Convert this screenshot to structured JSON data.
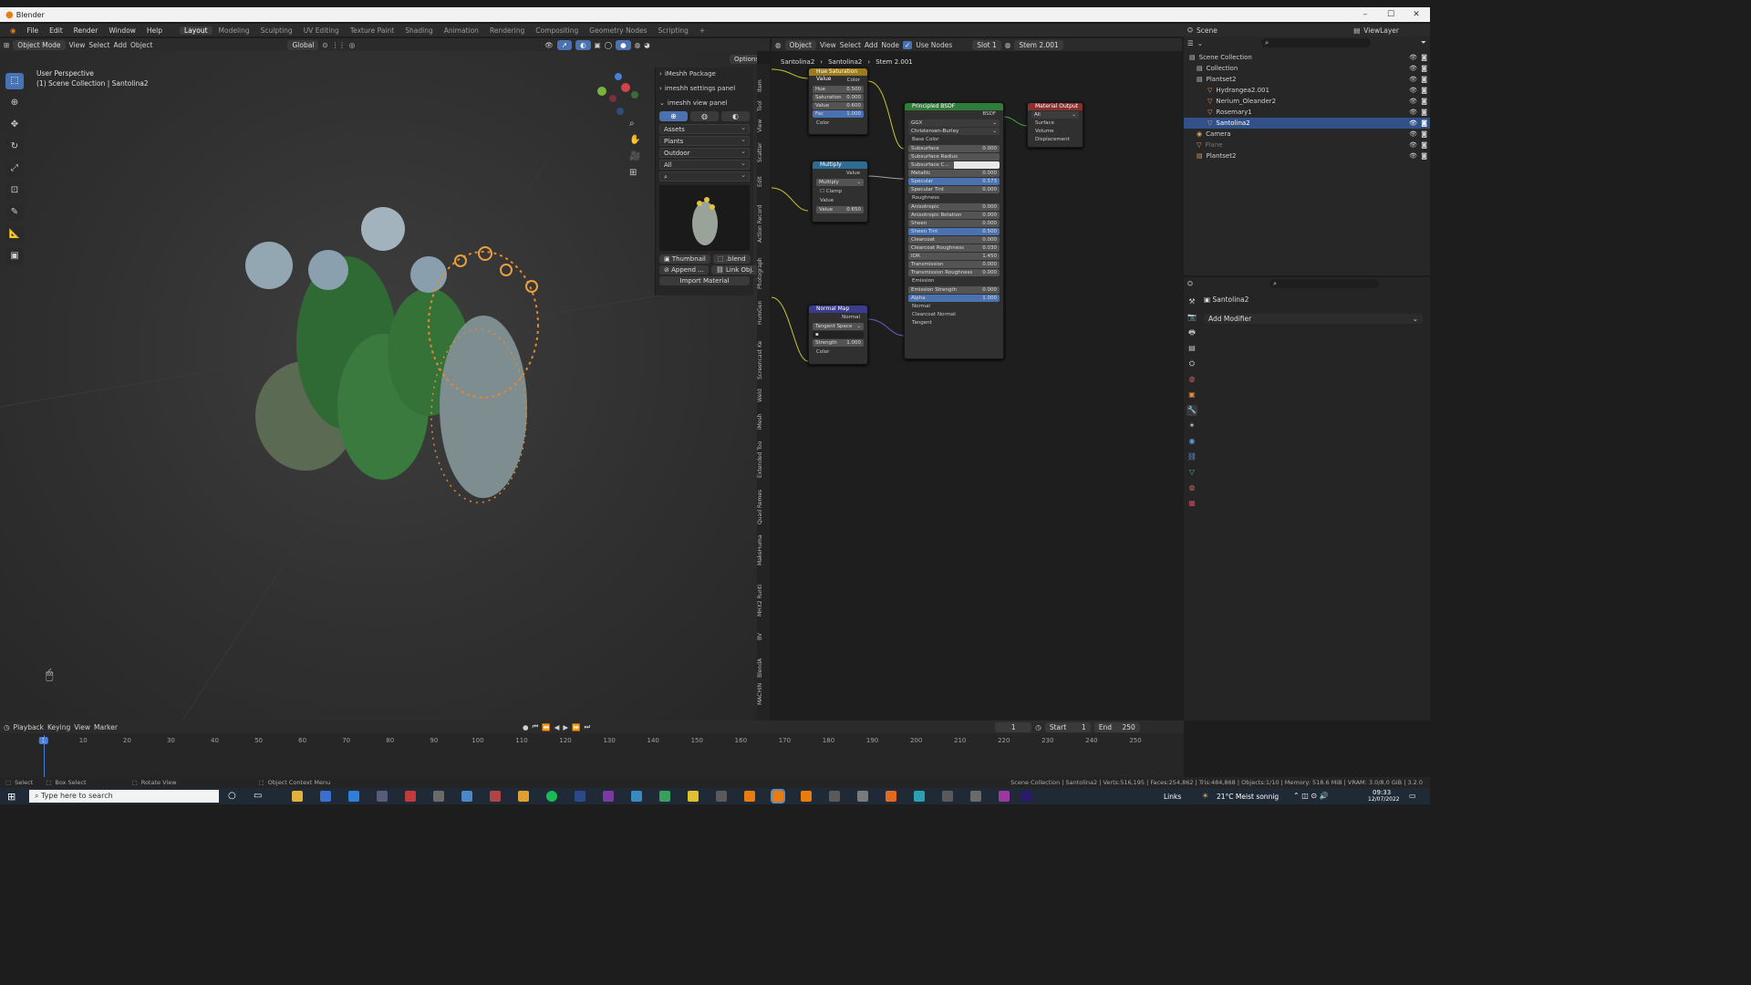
{
  "app": {
    "title": "Blender"
  },
  "menu": [
    "File",
    "Edit",
    "Render",
    "Window",
    "Help"
  ],
  "workspaces": [
    "Layout",
    "Modeling",
    "Sculpting",
    "UV Editing",
    "Texture Paint",
    "Shading",
    "Animation",
    "Rendering",
    "Compositing",
    "Geometry Nodes",
    "Scripting"
  ],
  "workspace_add": "+",
  "viewport": {
    "mode": "Object Mode",
    "menus": [
      "View",
      "Select",
      "Add",
      "Object"
    ],
    "orientation": "Global",
    "options": "Options",
    "overlay_title": "User Perspective",
    "overlay_sub": "(1) Scene Collection | Santolina2"
  },
  "npanel": {
    "headers": [
      "iMeshh Package",
      "imeshh settings panel",
      "imeshh view panel"
    ],
    "selects": [
      "Assets",
      "Plants",
      "Outdoor",
      "All"
    ],
    "thumbnail": "Thumbnail",
    "blend": ".blend",
    "append": "Append ...",
    "link": "Link Obj.",
    "import": "Import Material"
  },
  "vtabs": [
    "Item",
    "Tool",
    "View",
    "Scatter",
    "Edit",
    "Action Record",
    "Photograph",
    "HumGen",
    "Screencast Ke",
    "Weld",
    "iMesh",
    "Extended Too",
    "Quad Remes",
    "MakeHuma",
    "MHX2 Runti",
    "BV",
    "BlendA",
    "MACHIN"
  ],
  "node_editor": {
    "header": {
      "object": "Object",
      "menus": [
        "View",
        "Select",
        "Add",
        "Node"
      ],
      "use_nodes": "Use Nodes",
      "slot": "Slot 1",
      "material": "Stem 2.001"
    },
    "breadcrumb": [
      "Santolina2",
      "Santolina2",
      "Stem 2.001"
    ],
    "hsv": {
      "title": "Hue Saturation Value",
      "out": "Color",
      "fields": [
        {
          "l": "Hue",
          "v": "0.500"
        },
        {
          "l": "Saturation",
          "v": "0.000"
        },
        {
          "l": "Value",
          "v": "0.600"
        },
        {
          "l": "Fac",
          "v": "1.000"
        }
      ],
      "in": "Color"
    },
    "multiply": {
      "title": "Multiply",
      "out": "Value",
      "op": "Multiply",
      "clamp": "Clamp",
      "in": "Value",
      "value_l": "Value",
      "value_v": "0.650"
    },
    "normalmap": {
      "title": "Normal Map",
      "out": "Normal",
      "space": "Tangent Space",
      "strength_l": "Strength",
      "strength_v": "1.000",
      "in": "Color"
    },
    "bsdf": {
      "title": "Principled BSDF",
      "out": "BSDF",
      "dist": "GGX",
      "ss": "Christensen-Burley",
      "rows": [
        {
          "l": "Base Color",
          "v": ""
        },
        {
          "l": "Subsurface",
          "v": "0.000",
          "f": 1
        },
        {
          "l": "Subsurface Radius",
          "v": "",
          "f": 1
        },
        {
          "l": "Subsurface C...",
          "v": "",
          "f": 1,
          "w": 1
        },
        {
          "l": "Metallic",
          "v": "0.000",
          "f": 1
        },
        {
          "l": "Specular",
          "v": "0.573",
          "f": 1,
          "b": 1
        },
        {
          "l": "Specular Tint",
          "v": "0.000",
          "f": 1
        },
        {
          "l": "Roughness",
          "v": ""
        },
        {
          "l": "Anisotropic",
          "v": "0.000",
          "f": 1
        },
        {
          "l": "Anisotropic Rotation",
          "v": "0.000",
          "f": 1
        },
        {
          "l": "Sheen",
          "v": "0.000",
          "f": 1
        },
        {
          "l": "Sheen Tint",
          "v": "0.500",
          "f": 1,
          "b": 1
        },
        {
          "l": "Clearcoat",
          "v": "0.000",
          "f": 1
        },
        {
          "l": "Clearcoat Roughness",
          "v": "0.030",
          "f": 1
        },
        {
          "l": "IOR",
          "v": "1.450",
          "f": 1
        },
        {
          "l": "Transmission",
          "v": "0.000",
          "f": 1
        },
        {
          "l": "Transmission Roughness",
          "v": "0.000",
          "f": 1
        },
        {
          "l": "Emission",
          "v": ""
        },
        {
          "l": "Emission Strength",
          "v": "0.000",
          "f": 1
        },
        {
          "l": "Alpha",
          "v": "1.000",
          "f": 1,
          "b": 1
        },
        {
          "l": "Normal",
          "v": ""
        },
        {
          "l": "Clearcoat Normal",
          "v": ""
        },
        {
          "l": "Tangent",
          "v": ""
        }
      ]
    },
    "output": {
      "title": "Material Output",
      "target": "All",
      "rows": [
        "Surface",
        "Volume",
        "Displacement"
      ]
    }
  },
  "outliner": {
    "scene": "Scene",
    "viewlayer": "ViewLayer",
    "rows": [
      "Scene Collection",
      "Collection",
      "Plantset2",
      "Hydrangea2.001",
      "Nerium_Oleander2",
      "Rosemary1",
      "Santolina2",
      "Camera",
      "Plane",
      "Plantset2"
    ]
  },
  "properties": {
    "object": "Santolina2",
    "add_modifier": "Add Modifier"
  },
  "timeline": {
    "menus": [
      "Playback",
      "Keying",
      "View",
      "Marker"
    ],
    "current": "1",
    "start_l": "Start",
    "start": "1",
    "end_l": "End",
    "end": "250",
    "ticks": [
      "1",
      "10",
      "20",
      "30",
      "40",
      "50",
      "60",
      "70",
      "80",
      "90",
      "100",
      "110",
      "120",
      "130",
      "140",
      "150",
      "160",
      "170",
      "180",
      "190",
      "200",
      "210",
      "220",
      "230",
      "240",
      "250"
    ]
  },
  "status": {
    "select": "Select",
    "box": "Box Select",
    "rotate": "Rotate View",
    "ctx": "Object Context Menu",
    "info": "Scene Collection | Santolina2 | Verts:516,195 | Faces:254,862 | Tris:484,868 | Objects:1/10 | Memory: 518.6 MiB | VRAM: 3.0/8.0 GiB | 3.2.0"
  },
  "taskbar": {
    "search": "Type here to search",
    "links": "Links",
    "weather": "21°C Meist sonnig",
    "time": "09:33",
    "date": "12/07/2022"
  }
}
